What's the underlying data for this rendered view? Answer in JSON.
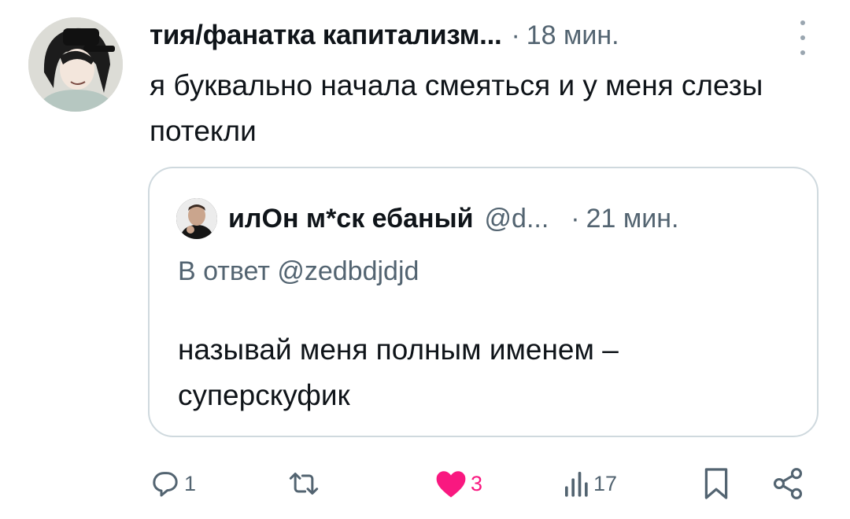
{
  "tweet": {
    "author_name": "тия/фанатка капитализм...",
    "time_separator": "·",
    "time": "18 мин.",
    "text": "я буквально начала смеяться и у меня слезы потекли"
  },
  "quoted_tweet": {
    "author_name": "илОн м*ск ебаный",
    "handle": "@d...",
    "time_separator": "·",
    "time": "21 мин.",
    "reply_to": "В ответ @zedbdjdjd",
    "text": "называй меня полным именем – суперскуфик"
  },
  "actions": {
    "reply_count": "1",
    "retweet_count": "",
    "like_count": "3",
    "views_count": "17",
    "like_color": "#f91880",
    "icon_color": "#536471"
  },
  "icons": [
    "more-vertical-icon",
    "reply-icon",
    "retweet-icon",
    "heart-icon",
    "views-icon",
    "bookmark-icon",
    "share-icon"
  ]
}
